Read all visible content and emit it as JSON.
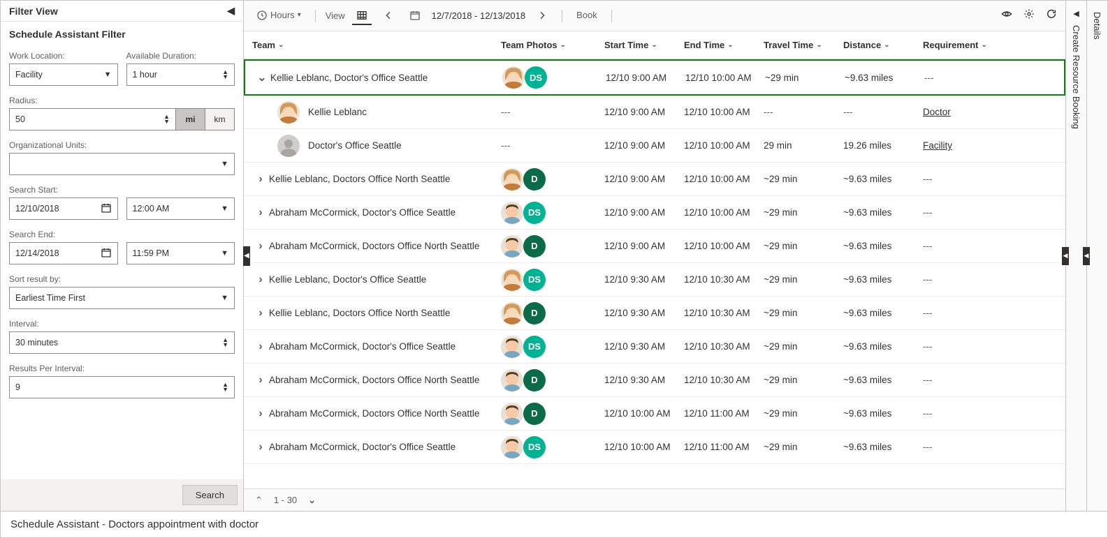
{
  "filter": {
    "title": "Filter View",
    "subtitle": "Schedule Assistant Filter",
    "work_location_label": "Work Location:",
    "work_location_value": "Facility",
    "available_duration_label": "Available Duration:",
    "available_duration_value": "1 hour",
    "radius_label": "Radius:",
    "radius_value": "50",
    "unit_mi": "mi",
    "unit_km": "km",
    "org_units_label": "Organizational Units:",
    "org_units_value": "",
    "search_start_label": "Search Start:",
    "search_start_date": "12/10/2018",
    "search_start_time": "12:00 AM",
    "search_end_label": "Search End:",
    "search_end_date": "12/14/2018",
    "search_end_time": "11:59 PM",
    "sort_label": "Sort result by:",
    "sort_value": "Earliest Time First",
    "interval_label": "Interval:",
    "interval_value": "30 minutes",
    "rpi_label": "Results Per Interval:",
    "rpi_value": "9",
    "search_button": "Search"
  },
  "toolbar": {
    "hours_label": "Hours",
    "view_label": "View",
    "date_range": "12/7/2018 - 12/13/2018",
    "book_label": "Book"
  },
  "columns": {
    "team": "Team",
    "photos": "Team Photos",
    "start": "Start Time",
    "end": "End Time",
    "travel": "Travel Time",
    "distance": "Distance",
    "req": "Requirement"
  },
  "rows": [
    {
      "expand": "open",
      "team": "Kellie Leblanc, Doctor's Office Seattle",
      "av": "f",
      "badge": "DS",
      "start": "12/10 9:00 AM",
      "end": "12/10 10:00 AM",
      "travel": "~29 min",
      "dist": "~9.63 miles",
      "req": "---",
      "selected": true
    },
    {
      "child": true,
      "name": "Kellie Leblanc",
      "av": "f",
      "photos": "---",
      "start": "12/10 9:00 AM",
      "end": "12/10 10:00 AM",
      "travel": "---",
      "dist": "---",
      "req": "Doctor",
      "reqlink": true
    },
    {
      "child": true,
      "name": "Doctor's Office Seattle",
      "av": "gray",
      "photos": "---",
      "start": "12/10 9:00 AM",
      "end": "12/10 10:00 AM",
      "travel": "29 min",
      "dist": "19.26 miles",
      "req": "Facility",
      "reqlink": true
    },
    {
      "team": "Kellie Leblanc, Doctors Office North Seattle",
      "av": "f",
      "badge": "D",
      "start": "12/10 9:00 AM",
      "end": "12/10 10:00 AM",
      "travel": "~29 min",
      "dist": "~9.63 miles",
      "req": "---"
    },
    {
      "team": "Abraham McCormick, Doctor's Office Seattle",
      "av": "m",
      "badge": "DS",
      "start": "12/10 9:00 AM",
      "end": "12/10 10:00 AM",
      "travel": "~29 min",
      "dist": "~9.63 miles",
      "req": "---"
    },
    {
      "team": "Abraham McCormick, Doctors Office North Seattle",
      "av": "m",
      "badge": "D",
      "start": "12/10 9:00 AM",
      "end": "12/10 10:00 AM",
      "travel": "~29 min",
      "dist": "~9.63 miles",
      "req": "---"
    },
    {
      "team": "Kellie Leblanc, Doctor's Office Seattle",
      "av": "f",
      "badge": "DS",
      "start": "12/10 9:30 AM",
      "end": "12/10 10:30 AM",
      "travel": "~29 min",
      "dist": "~9.63 miles",
      "req": "---"
    },
    {
      "team": "Kellie Leblanc, Doctors Office North Seattle",
      "av": "f",
      "badge": "D",
      "start": "12/10 9:30 AM",
      "end": "12/10 10:30 AM",
      "travel": "~29 min",
      "dist": "~9.63 miles",
      "req": "---"
    },
    {
      "team": "Abraham McCormick, Doctor's Office Seattle",
      "av": "m",
      "badge": "DS",
      "start": "12/10 9:30 AM",
      "end": "12/10 10:30 AM",
      "travel": "~29 min",
      "dist": "~9.63 miles",
      "req": "---"
    },
    {
      "team": "Abraham McCormick, Doctors Office North Seattle",
      "av": "m",
      "badge": "D",
      "start": "12/10 9:30 AM",
      "end": "12/10 10:30 AM",
      "travel": "~29 min",
      "dist": "~9.63 miles",
      "req": "---"
    },
    {
      "team": "Abraham McCormick, Doctors Office North Seattle",
      "av": "m",
      "badge": "D",
      "start": "12/10 10:00 AM",
      "end": "12/10 11:00 AM",
      "travel": "~29 min",
      "dist": "~9.63 miles",
      "req": "---"
    },
    {
      "team": "Abraham McCormick, Doctor's Office Seattle",
      "av": "m",
      "badge": "DS",
      "start": "12/10 10:00 AM",
      "end": "12/10 11:00 AM",
      "travel": "~29 min",
      "dist": "~9.63 miles",
      "req": "---"
    }
  ],
  "pager": {
    "range": "1 - 30"
  },
  "right_panes": {
    "create": "Create Resource Booking",
    "details": "Details"
  },
  "footer": "Schedule Assistant - Doctors appointment with doctor"
}
